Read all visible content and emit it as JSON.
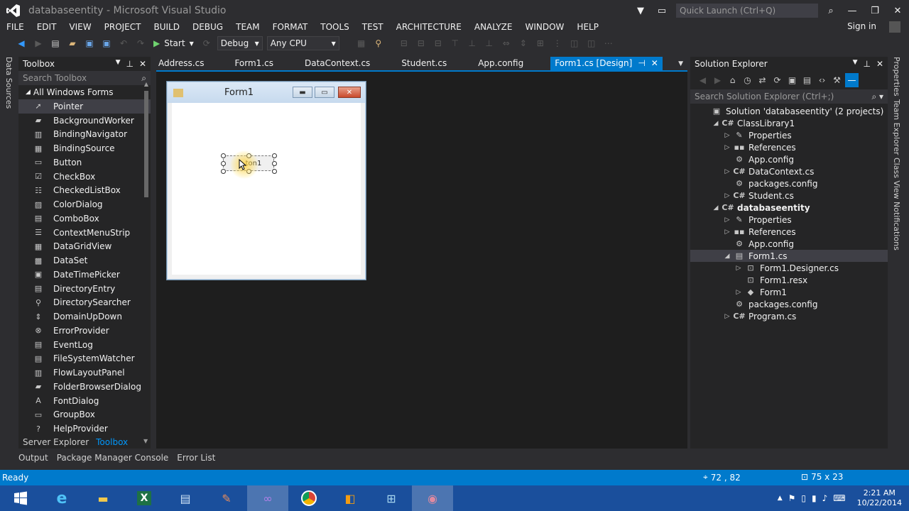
{
  "window": {
    "title": "databaseentity - Microsoft Visual Studio",
    "quick_launch_placeholder": "Quick Launch (Ctrl+Q)",
    "sign_in": "Sign in"
  },
  "menu": [
    "FILE",
    "EDIT",
    "VIEW",
    "PROJECT",
    "BUILD",
    "DEBUG",
    "TEAM",
    "FORMAT",
    "TOOLS",
    "TEST",
    "ARCHITECTURE",
    "ANALYZE",
    "WINDOW",
    "HELP"
  ],
  "toolbar": {
    "start_label": "Start",
    "config": "Debug",
    "platform": "Any CPU"
  },
  "left_strip": {
    "label": "Data Sources"
  },
  "toolbox": {
    "title": "Toolbox",
    "search_placeholder": "Search Toolbox",
    "group": "All Windows Forms",
    "items": [
      {
        "label": "Pointer",
        "icon": "pointer-icon"
      },
      {
        "label": "BackgroundWorker",
        "icon": "background-worker-icon"
      },
      {
        "label": "BindingNavigator",
        "icon": "binding-navigator-icon"
      },
      {
        "label": "BindingSource",
        "icon": "binding-source-icon"
      },
      {
        "label": "Button",
        "icon": "button-icon"
      },
      {
        "label": "CheckBox",
        "icon": "checkbox-icon"
      },
      {
        "label": "CheckedListBox",
        "icon": "checked-list-icon"
      },
      {
        "label": "ColorDialog",
        "icon": "color-dialog-icon"
      },
      {
        "label": "ComboBox",
        "icon": "combobox-icon"
      },
      {
        "label": "ContextMenuStrip",
        "icon": "context-menu-icon"
      },
      {
        "label": "DataGridView",
        "icon": "datagrid-icon"
      },
      {
        "label": "DataSet",
        "icon": "dataset-icon"
      },
      {
        "label": "DateTimePicker",
        "icon": "datetime-icon"
      },
      {
        "label": "DirectoryEntry",
        "icon": "directory-entry-icon"
      },
      {
        "label": "DirectorySearcher",
        "icon": "directory-searcher-icon"
      },
      {
        "label": "DomainUpDown",
        "icon": "domain-updown-icon"
      },
      {
        "label": "ErrorProvider",
        "icon": "error-provider-icon"
      },
      {
        "label": "EventLog",
        "icon": "event-log-icon"
      },
      {
        "label": "FileSystemWatcher",
        "icon": "file-watcher-icon"
      },
      {
        "label": "FlowLayoutPanel",
        "icon": "flow-layout-icon"
      },
      {
        "label": "FolderBrowserDialog",
        "icon": "folder-browser-icon"
      },
      {
        "label": "FontDialog",
        "icon": "font-dialog-icon"
      },
      {
        "label": "GroupBox",
        "icon": "groupbox-icon"
      },
      {
        "label": "HelpProvider",
        "icon": "help-provider-icon"
      }
    ],
    "bottom_tabs": [
      "Server Explorer",
      "Toolbox"
    ]
  },
  "doc_tabs": [
    "Address.cs",
    "Form1.cs",
    "DataContext.cs",
    "Student.cs",
    "App.config",
    "Form1.cs [Design]"
  ],
  "designer": {
    "form_title": "Form1",
    "button_text": "ton1"
  },
  "solution_explorer": {
    "title": "Solution Explorer",
    "search_placeholder": "Search Solution Explorer (Ctrl+;)",
    "nodes": [
      {
        "label": "Solution 'databaseentity' (2 projects)",
        "depth": 0,
        "arrow": "",
        "icon": "solution-icon",
        "bold": false
      },
      {
        "label": "ClassLibrary1",
        "depth": 1,
        "arrow": "open",
        "icon": "csharp-project-icon",
        "bold": false
      },
      {
        "label": "Properties",
        "depth": 2,
        "arrow": "closed",
        "icon": "wrench-icon",
        "bold": false
      },
      {
        "label": "References",
        "depth": 2,
        "arrow": "closed",
        "icon": "references-icon",
        "bold": false
      },
      {
        "label": "App.config",
        "depth": 2,
        "arrow": "",
        "icon": "config-icon",
        "bold": false
      },
      {
        "label": "DataContext.cs",
        "depth": 2,
        "arrow": "closed",
        "icon": "csharp-file-icon",
        "bold": false
      },
      {
        "label": "packages.config",
        "depth": 2,
        "arrow": "",
        "icon": "config-icon",
        "bold": false
      },
      {
        "label": "Student.cs",
        "depth": 2,
        "arrow": "closed",
        "icon": "csharp-file-icon",
        "bold": false
      },
      {
        "label": "databaseentity",
        "depth": 1,
        "arrow": "open",
        "icon": "csharp-project-icon",
        "bold": true
      },
      {
        "label": "Properties",
        "depth": 2,
        "arrow": "closed",
        "icon": "wrench-icon",
        "bold": false
      },
      {
        "label": "References",
        "depth": 2,
        "arrow": "closed",
        "icon": "references-icon",
        "bold": false
      },
      {
        "label": "App.config",
        "depth": 2,
        "arrow": "",
        "icon": "config-icon",
        "bold": false
      },
      {
        "label": "Form1.cs",
        "depth": 2,
        "arrow": "open",
        "icon": "form-icon",
        "bold": false,
        "selected": true
      },
      {
        "label": "Form1.Designer.cs",
        "depth": 3,
        "arrow": "closed",
        "icon": "designer-file-icon",
        "bold": false
      },
      {
        "label": "Form1.resx",
        "depth": 3,
        "arrow": "",
        "icon": "resx-icon",
        "bold": false
      },
      {
        "label": "Form1",
        "depth": 3,
        "arrow": "closed",
        "icon": "class-icon",
        "bold": false
      },
      {
        "label": "packages.config",
        "depth": 2,
        "arrow": "",
        "icon": "config-icon",
        "bold": false
      },
      {
        "label": "Program.cs",
        "depth": 2,
        "arrow": "closed",
        "icon": "csharp-file-icon",
        "bold": false
      }
    ]
  },
  "right_strip": [
    "Properties",
    "Team Explorer",
    "Class View",
    "Notifications"
  ],
  "output_tabs": [
    "Output",
    "Package Manager Console",
    "Error List"
  ],
  "status": {
    "text": "Ready",
    "position": "72 , 82",
    "size": "75 x 23"
  },
  "taskbar": {
    "time": "2:21 AM",
    "date": "10/22/2014"
  },
  "colors": {
    "accent": "#007acc",
    "background": "#2d2d30",
    "panel": "#252526",
    "taskbar": "#1a4f9c"
  }
}
